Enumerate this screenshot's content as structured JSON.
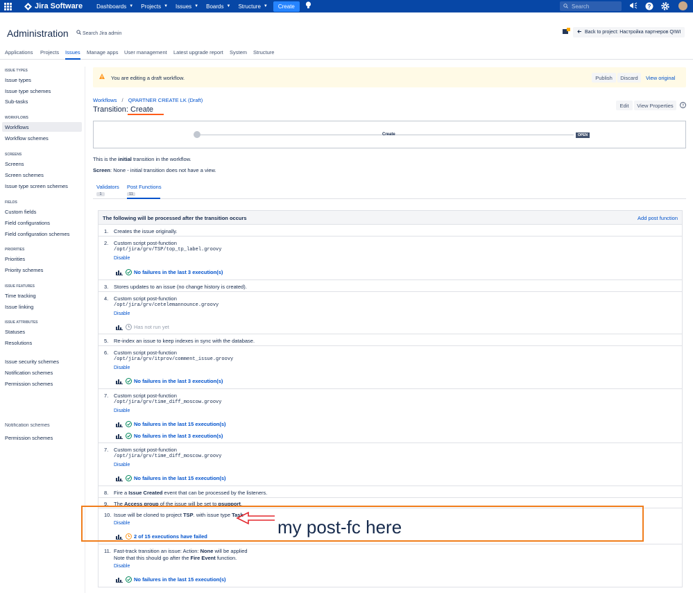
{
  "topnav": {
    "brand": "Jira Software",
    "items": [
      "Dashboards",
      "Projects",
      "Issues",
      "Boards",
      "Structure"
    ],
    "create": "Create",
    "search_placeholder": "Search"
  },
  "header": {
    "title": "Administration",
    "search": "Search Jira admin",
    "back": "Back to project: Настройка партнеров QIWI"
  },
  "tabs": [
    "Applications",
    "Projects",
    "Issues",
    "Manage apps",
    "User management",
    "Latest upgrade report",
    "System",
    "Structure"
  ],
  "sidebar": {
    "sections": [
      {
        "h": "ISSUE TYPES",
        "items": [
          "Issue types",
          "Issue type schemes",
          "Sub-tasks"
        ]
      },
      {
        "h": "WORKFLOWS",
        "items": [
          "Workflows",
          "Workflow schemes"
        ]
      },
      {
        "h": "SCREENS",
        "items": [
          "Screens",
          "Screen schemes",
          "Issue type screen schemes"
        ]
      },
      {
        "h": "FIELDS",
        "items": [
          "Custom fields",
          "Field configurations",
          "Field configuration schemes"
        ]
      },
      {
        "h": "PRIORITIES",
        "items": [
          "Priorities",
          "Priority schemes"
        ]
      },
      {
        "h": "ISSUE FEATURES",
        "items": [
          "Time tracking",
          "Issue linking"
        ]
      },
      {
        "h": "ISSUE ATTRIBUTES",
        "items": [
          "Statuses",
          "Resolutions"
        ]
      }
    ],
    "extra": [
      "Issue security schemes",
      "Notification schemes",
      "Permission schemes"
    ],
    "extra2": [
      "Notification schemes",
      "Permission schemes"
    ]
  },
  "warning": {
    "text": "You are editing a draft workflow.",
    "publish": "Publish",
    "discard": "Discard",
    "view_original": "View original"
  },
  "breadcrumbs": {
    "workflows": "Workflows",
    "sep": "/",
    "draft": "QPARTNER CREATE LK (Draft)"
  },
  "transition": {
    "prefix": "Transition: ",
    "name": "Create",
    "edit": "Edit",
    "view_props": "View Properties"
  },
  "diagram": {
    "label": "Create",
    "status": "OPEN"
  },
  "info": {
    "line1_a": "This is the ",
    "line1_b": "initial",
    "line1_c": " transition in the workflow.",
    "line2_a": "Screen",
    "line2_b": ": None - initial transition does not have a view."
  },
  "subtabs": [
    {
      "label": "Validators",
      "count": "1"
    },
    {
      "label": "Post Functions",
      "count": "11"
    }
  ],
  "pf": {
    "header": "The following will be processed after the transition occurs",
    "add": "Add post function",
    "disable": "Disable",
    "items": [
      {
        "n": "1.",
        "t": "Creates the issue originally."
      },
      {
        "n": "2.",
        "t": "Custom script post-function",
        "m": "/opt/jira/grv/TSP/top_tp_label.groovy",
        "s": [
          "No failures in the last 3 execution(s)"
        ]
      },
      {
        "n": "3.",
        "t": "Stores updates to an issue (no change history is created)."
      },
      {
        "n": "4.",
        "t": "Custom script post-function",
        "m": "/opt/jira/grv/cetelemannounce.groovy",
        "s": [
          "Has not run yet"
        ]
      },
      {
        "n": "5.",
        "t": "Re-index an issue to keep indexes in sync with the database."
      },
      {
        "n": "6.",
        "t": "Custom script post-function",
        "m": "/opt/jira/grv/itprov/comment_issue.groovy",
        "s": [
          "No failures in the last 3 execution(s)"
        ]
      },
      {
        "n": "7.",
        "t": "Custom script post-function",
        "m": "/opt/jira/grv/time_diff_moscow.groovy",
        "s": [
          "No failures in the last 15 execution(s)",
          "No failures in the last 3 execution(s)"
        ]
      },
      {
        "n": "7.",
        "t": "Custom script post-function",
        "m": "/opt/jira/grv/time_diff_moscow.groovy",
        "s": [
          "No failures in the last 15 execution(s)"
        ]
      },
      {
        "n": "8.",
        "t_a": "Fire a ",
        "t_b": "Issue Created",
        "t_c": " event that can be processed by the listeners."
      },
      {
        "n": "9.",
        "t_a": "The ",
        "t_b": "Access group",
        "t_c": " of the issue will be set to ",
        "t_d": "psupport",
        "t_e": "."
      },
      {
        "n": "10.",
        "t_a": "Issue will be cloned to project ",
        "t_b": "TSP",
        "t_c": ". with issue type ",
        "t_d": "Task",
        "s": [
          "2 of 15 executions have failed"
        ]
      },
      {
        "n": "11.",
        "t_a": "Fast-track transition an issue: Action: ",
        "t_b": "None",
        "t_c": " will be applied",
        "l2_a": "Note that this should go after the ",
        "l2_b": "Fire Event",
        "l2_c": " function.",
        "s": [
          "No failures in the last 15 execution(s)"
        ]
      }
    ]
  },
  "annotation": "my post-fc here"
}
